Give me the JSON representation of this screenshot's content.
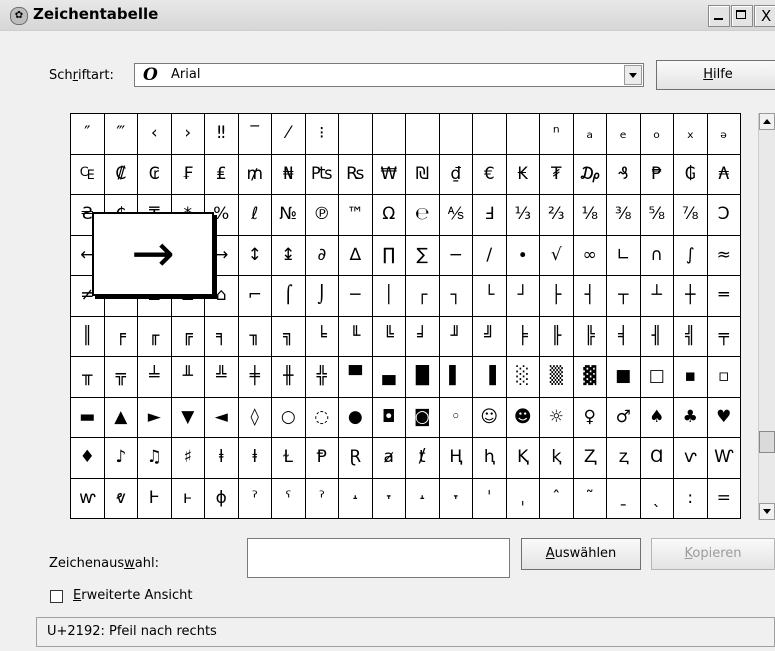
{
  "window": {
    "title": "Zeichentabelle",
    "close_glyph": "X"
  },
  "font_row": {
    "label_pre": "Sch",
    "label_accel": "r",
    "label_post": "iftart:",
    "font_glyph": "O",
    "font_value": "Arial",
    "help_accel": "H",
    "help_rest": "ilfe"
  },
  "grid": {
    "rows": [
      [
        "″",
        "‴",
        "‹",
        "›",
        "‼",
        "‾",
        "⁄",
        "⁝",
        "",
        "",
        "",
        "",
        "",
        "",
        "ⁿ",
        "ₐ",
        "ₑ",
        "ₒ",
        "ₓ",
        "ₔ"
      ],
      [
        "₠",
        "₡",
        "₢",
        "₣",
        "₤",
        "₥",
        "₦",
        "₧",
        "₨",
        "₩",
        "₪",
        "₫",
        "€",
        "₭",
        "₮",
        "₯",
        "₰",
        "₱",
        "₲",
        "₳"
      ],
      [
        "₴",
        "₵",
        "₸",
        "*",
        "%",
        "ℓ",
        "№",
        "℗",
        "™",
        "Ω",
        "℮",
        "⅍",
        "Ⅎ",
        "⅓",
        "⅔",
        "⅛",
        "⅜",
        "⅝",
        "⅞",
        "Ↄ"
      ],
      [
        "←",
        "↑",
        "→",
        "↓",
        "→",
        "↕",
        "↨",
        "∂",
        "∆",
        "∏",
        "∑",
        "−",
        "∕",
        "∙",
        "√",
        "∞",
        "∟",
        "∩",
        "∫",
        "≈"
      ],
      [
        "≠",
        "≡",
        "≤",
        "≥",
        "⌂",
        "⌐",
        "⌠",
        "⌡",
        "─",
        "│",
        "┌",
        "┐",
        "└",
        "┘",
        "├",
        "┤",
        "┬",
        "┴",
        "┼",
        "═"
      ],
      [
        "║",
        "╒",
        "╓",
        "╔",
        "╕",
        "╖",
        "╗",
        "╘",
        "╙",
        "╚",
        "╛",
        "╜",
        "╝",
        "╞",
        "╟",
        "╠",
        "╡",
        "╢",
        "╣",
        "╤"
      ],
      [
        "╥",
        "╦",
        "╧",
        "╨",
        "╩",
        "╪",
        "╫",
        "╬",
        "▀",
        "▄",
        "█",
        "▌",
        "▐",
        "░",
        "▒",
        "▓",
        "■",
        "□",
        "▪",
        "▫"
      ],
      [
        "▬",
        "▲",
        "►",
        "▼",
        "◄",
        "◊",
        "○",
        "◌",
        "●",
        "◘",
        "◙",
        "◦",
        "☺",
        "☻",
        "☼",
        "♀",
        "♂",
        "♠",
        "♣",
        "♥"
      ],
      [
        "♦",
        "♪",
        "♫",
        "♯",
        "ⱡ",
        "ⱡ",
        "Ɫ",
        "Ᵽ",
        "Ɽ",
        "ⱥ",
        "ⱦ",
        "Ⱨ",
        "ⱨ",
        "Ⱪ",
        "ⱪ",
        "Ⱬ",
        "ⱬ",
        "Ɑ",
        "ⱱ",
        "Ⱳ"
      ],
      [
        "ⱳ",
        "ⱴ",
        "Ⱶ",
        "ⱶ",
        "ɸ",
        "ˀ",
        "ˁ",
        "ˀ",
        "˔",
        "˕",
        "˔",
        "˕",
        "ˈ",
        "ˌ",
        "ˆ",
        "˜",
        "ˍ",
        "ˎ",
        ":",
        "="
      ]
    ]
  },
  "magnifier": {
    "glyph": "→"
  },
  "selection": {
    "label_pre": "Zeichenaus",
    "label_accel": "w",
    "label_post": "ahl:",
    "value": "",
    "select_accel": "A",
    "select_rest": "uswählen",
    "copy_accel": "K",
    "copy_rest": "opieren"
  },
  "extended": {
    "accel": "E",
    "rest": "rweiterte Ansicht",
    "checked": false
  },
  "status": {
    "text": "U+2192: Pfeil nach rechts"
  }
}
